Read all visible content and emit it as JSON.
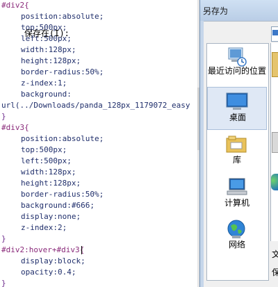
{
  "editor": {
    "lines": [
      "#div2{",
      "position:absolute;",
      "top:500px;",
      "left:500px;",
      "width:128px;",
      "height:128px;",
      "border-radius:50%;",
      "z-index:1;",
      "background:",
      "url(../Downloads/panda_128px_1179072_easy",
      "}",
      "#div3{",
      "position:absolute;",
      "top:500px;",
      "left:500px;",
      "width:128px;",
      "height:128px;",
      "border-radius:50%;",
      "background:#666;",
      "display:none;",
      "z-index:2;",
      "}",
      "#div2:hover+#div3{",
      "display:block;",
      "opacity:0.4;",
      "}"
    ]
  },
  "dialog": {
    "title": "另存为",
    "save_in_label": "保存在(I):",
    "places": [
      {
        "label": "最近访问的位置",
        "icon": "recent-places-icon"
      },
      {
        "label": "桌面",
        "icon": "desktop-icon"
      },
      {
        "label": "库",
        "icon": "libraries-icon"
      },
      {
        "label": "计算机",
        "icon": "computer-icon"
      },
      {
        "label": "网络",
        "icon": "network-icon"
      }
    ],
    "file_name_label_partial": "文",
    "save_type_label_partial": "保"
  }
}
